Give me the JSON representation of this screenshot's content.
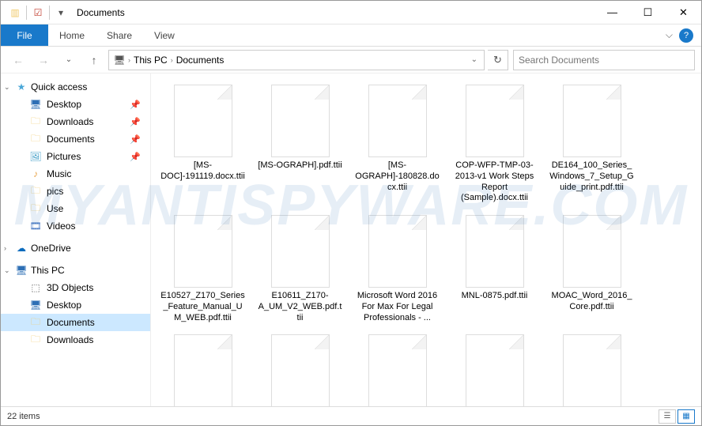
{
  "title": "Documents",
  "ribbon": {
    "file": "File",
    "tabs": [
      "Home",
      "Share",
      "View"
    ]
  },
  "breadcrumb": {
    "root": "This PC",
    "folder": "Documents"
  },
  "search": {
    "placeholder": "Search Documents"
  },
  "sidebar": {
    "quick": {
      "label": "Quick access",
      "items": [
        {
          "icon": "monitor",
          "label": "Desktop",
          "pinned": true
        },
        {
          "icon": "folder",
          "label": "Downloads",
          "pinned": true
        },
        {
          "icon": "folder",
          "label": "Documents",
          "pinned": true
        },
        {
          "icon": "pic",
          "label": "Pictures",
          "pinned": true
        },
        {
          "icon": "music",
          "label": "Music",
          "pinned": false
        },
        {
          "icon": "folder",
          "label": "pics",
          "pinned": false
        },
        {
          "icon": "folder",
          "label": "Use",
          "pinned": false
        },
        {
          "icon": "video",
          "label": "Videos",
          "pinned": false
        }
      ]
    },
    "onedrive": {
      "label": "OneDrive"
    },
    "thispc": {
      "label": "This PC",
      "items": [
        {
          "icon": "pc",
          "label": "3D Objects"
        },
        {
          "icon": "monitor",
          "label": "Desktop"
        },
        {
          "icon": "folder",
          "label": "Documents",
          "selected": true
        },
        {
          "icon": "folder",
          "label": "Downloads"
        }
      ]
    }
  },
  "files": [
    "[MS-DOC]-191119.docx.ttii",
    "[MS-OGRAPH].pdf.ttii",
    "[MS-OGRAPH]-180828.docx.ttii",
    "COP-WFP-TMP-03-2013-v1 Work Steps Report (Sample).docx.ttii",
    "DE164_100_Series_Windows_7_Setup_Guide_print.pdf.ttii",
    "E10527_Z170_Series_Feature_Manual_UM_WEB.pdf.ttii",
    "E10611_Z170-A_UM_V2_WEB.pdf.ttii",
    "Microsoft Word 2016 For Max For Legal Professionals - ...",
    "MNL-0875.pdf.ttii",
    "MOAC_Word_2016_Core.pdf.ttii",
    "",
    "",
    "",
    "",
    ""
  ],
  "status": {
    "count": "22 items"
  },
  "watermark": "MYANTISPYWARE.COM"
}
